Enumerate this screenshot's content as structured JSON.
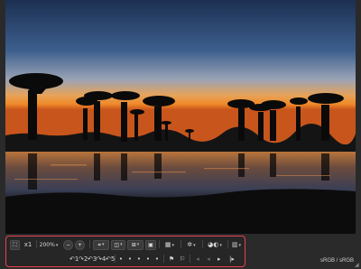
{
  "toolbar": {
    "fit_icon": "fit-to-window-icon",
    "actual_size_label": "x1",
    "zoom_level": "200%",
    "zoom_out_icon": "zoom-out-icon",
    "zoom_in_icon": "zoom-in-icon",
    "row2": {
      "rotate_items": [
        "↶1",
        "↷2",
        "↶3",
        "↷4",
        "↶5"
      ],
      "rating_dots": [
        "•",
        "•",
        "•",
        "•",
        "•"
      ],
      "nav_first": "◂",
      "nav_prev": "◂",
      "nav_next": "◂",
      "nav_last": "◂|"
    }
  },
  "status": {
    "color_space": "sRGB / sRGB"
  },
  "colors": {
    "highlight_border": "#e8414f",
    "sky_top": "#243a5e",
    "sky_horizon": "#f08a2a"
  }
}
